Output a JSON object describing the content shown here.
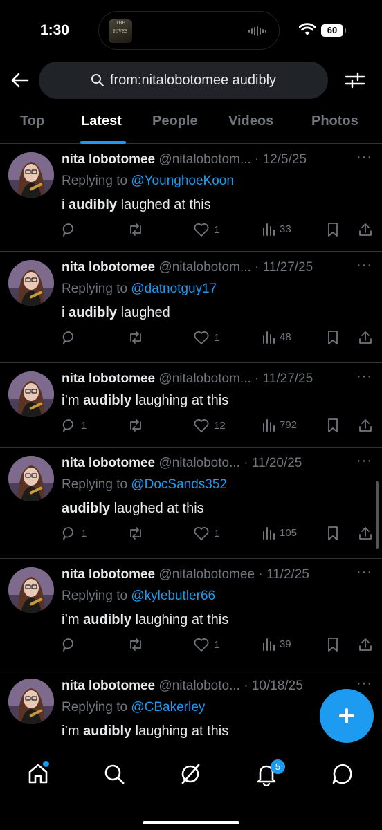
{
  "status_bar": {
    "time": "1:30",
    "album_label": "THE HIVES",
    "battery": "60"
  },
  "search": {
    "query": "from:nitalobotomee audibly"
  },
  "tabs": [
    {
      "label": "Top",
      "active": false
    },
    {
      "label": "Latest",
      "active": true
    },
    {
      "label": "People",
      "active": false
    },
    {
      "label": "Videos",
      "active": false
    },
    {
      "label": "Photos",
      "active": false
    }
  ],
  "tweets": [
    {
      "name": "nita lobotomee",
      "meta": "@nitalobotom... · 12/5/25",
      "replying_prefix": "Replying to ",
      "replying_handle": "@YounghoeKoon",
      "pre": "i ",
      "highlight": "audibly",
      "post": " laughed at this",
      "replies": "",
      "reposts": "",
      "likes": "1",
      "views": "33"
    },
    {
      "name": "nita lobotomee",
      "meta": "@nitalobotom... · 11/27/25",
      "replying_prefix": "Replying to ",
      "replying_handle": "@datnotguy17",
      "pre": "i ",
      "highlight": "audibly",
      "post": " laughed",
      "replies": "",
      "reposts": "",
      "likes": "1",
      "views": "48"
    },
    {
      "name": "nita lobotomee",
      "meta": "@nitalobotom... · 11/27/25",
      "replying_prefix": "",
      "replying_handle": "",
      "pre": "i’m ",
      "highlight": "audibly",
      "post": " laughing at this",
      "replies": "1",
      "reposts": "",
      "likes": "12",
      "views": "792"
    },
    {
      "name": "nita lobotomee",
      "meta": "@nitaloboto... · 11/20/25",
      "replying_prefix": "Replying to ",
      "replying_handle": "@DocSands352",
      "pre": "",
      "highlight": "audibly",
      "post": " laughed at this",
      "replies": "1",
      "reposts": "",
      "likes": "1",
      "views": "105"
    },
    {
      "name": "nita lobotomee",
      "meta": "@nitalobotomee · 11/2/25",
      "replying_prefix": "Replying to ",
      "replying_handle": "@kylebutler66",
      "pre": "i’m ",
      "highlight": "audibly",
      "post": " laughing at this",
      "replies": "",
      "reposts": "",
      "likes": "1",
      "views": "39"
    },
    {
      "name": "nita lobotomee",
      "meta": "@nitaloboto... · 10/18/25",
      "replying_prefix": "Replying to ",
      "replying_handle": "@CBakerley",
      "pre": "i’m ",
      "highlight": "audibly",
      "post": " laughing at this",
      "replies": "",
      "reposts": "",
      "likes": "",
      "views": ""
    }
  ],
  "bottom_nav": {
    "notifications_badge": "5"
  },
  "colors": {
    "accent": "#1d9bf0",
    "muted": "#71767b",
    "text": "#e7e9ea",
    "background": "#000000"
  }
}
